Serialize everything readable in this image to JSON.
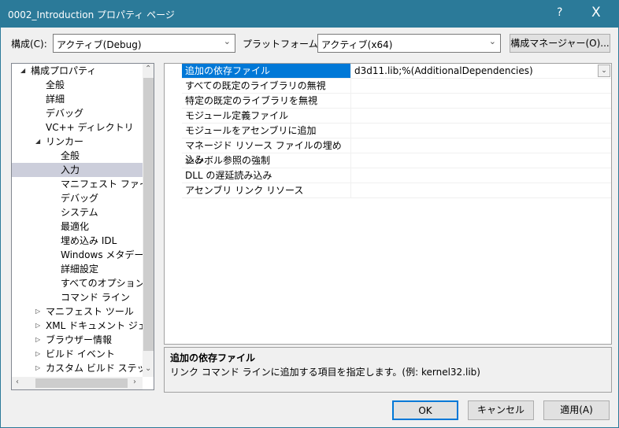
{
  "window": {
    "title": "0002_Introduction プロパティ ページ",
    "help": "?",
    "close": "X"
  },
  "toolbar": {
    "config_label": "構成(C):",
    "config_value": "アクティブ(Debug)",
    "platform_label": "プラットフォーム(P):",
    "platform_value": "アクティブ(x64)",
    "config_manager": "構成マネージャー(O)..."
  },
  "tree": {
    "items": [
      {
        "label": "構成プロパティ",
        "level": 0,
        "state": "expanded"
      },
      {
        "label": "全般",
        "level": 1
      },
      {
        "label": "詳細",
        "level": 1
      },
      {
        "label": "デバッグ",
        "level": 1
      },
      {
        "label": "VC++ ディレクトリ",
        "level": 1
      },
      {
        "label": "リンカー",
        "level": 1,
        "state": "expanded"
      },
      {
        "label": "全般",
        "level": 2
      },
      {
        "label": "入力",
        "level": 2,
        "selected": true
      },
      {
        "label": "マニフェスト ファイル",
        "level": 2
      },
      {
        "label": "デバッグ",
        "level": 2
      },
      {
        "label": "システム",
        "level": 2
      },
      {
        "label": "最適化",
        "level": 2
      },
      {
        "label": "埋め込み IDL",
        "level": 2
      },
      {
        "label": "Windows メタデータ",
        "level": 2
      },
      {
        "label": "詳細設定",
        "level": 2
      },
      {
        "label": "すべてのオプション",
        "level": 2
      },
      {
        "label": "コマンド ライン",
        "level": 2
      },
      {
        "label": "マニフェスト ツール",
        "level": 1,
        "state": "collapsed"
      },
      {
        "label": "XML ドキュメント ジェネレーター",
        "level": 1,
        "state": "collapsed"
      },
      {
        "label": "ブラウザー情報",
        "level": 1,
        "state": "collapsed"
      },
      {
        "label": "ビルド イベント",
        "level": 1,
        "state": "collapsed"
      },
      {
        "label": "カスタム ビルド ステップ",
        "level": 1,
        "state": "collapsed"
      }
    ]
  },
  "grid": {
    "rows": [
      {
        "name": "追加の依存ファイル",
        "value": "d3d11.lib;%(AdditionalDependencies)",
        "selected": true
      },
      {
        "name": "すべての既定のライブラリの無視",
        "value": ""
      },
      {
        "name": "特定の既定のライブラリを無視",
        "value": ""
      },
      {
        "name": "モジュール定義ファイル",
        "value": ""
      },
      {
        "name": "モジュールをアセンブリに追加",
        "value": ""
      },
      {
        "name": "マネージド リソース ファイルの埋め込み",
        "value": ""
      },
      {
        "name": "シンボル参照の強制",
        "value": ""
      },
      {
        "name": "DLL の遅延読み込み",
        "value": ""
      },
      {
        "name": "アセンブリ リンク リソース",
        "value": ""
      }
    ]
  },
  "description": {
    "title": "追加の依存ファイル",
    "text": "リンク コマンド ラインに追加する項目を指定します。(例: kernel32.lib)"
  },
  "buttons": {
    "ok": "OK",
    "cancel": "キャンセル",
    "apply": "適用(A)"
  },
  "colors": {
    "titlebar": "#2b7a99",
    "selection": "#0078d7",
    "tree_selection": "#cccedb"
  }
}
